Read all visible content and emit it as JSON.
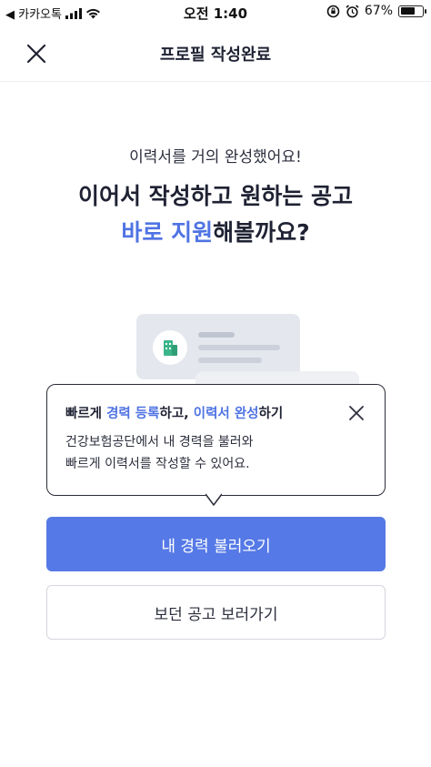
{
  "status_bar": {
    "back_app": "◀ 카카오톡",
    "time": "오전 1:40",
    "battery_percent": "67%",
    "battery_level": 0.67
  },
  "header": {
    "title": "프로필 작성완료"
  },
  "main": {
    "subtitle": "이력서를 거의 완성했어요!",
    "headline_line1": "이어서 작성하고 원하는 공고",
    "headline_accent": "바로 지원",
    "headline_tail": "해볼까요?"
  },
  "tooltip": {
    "title_part1": "빠르게 ",
    "title_accent1": "경력 등록",
    "title_part2": "하고, ",
    "title_accent2": "이력서 완성",
    "title_part3": "하기",
    "body_line1": "건강보험공단에서 내 경력을 불러와",
    "body_line2": "빠르게 이력서를 작성할 수 있어요."
  },
  "buttons": {
    "primary_label": "내 경력 불러오기",
    "secondary_label": "보던 공고 보러가기"
  },
  "colors": {
    "accent": "#4f73e3",
    "primary_button": "#5579e6",
    "illustration_icon": "#3bb58a"
  },
  "icons": {
    "close": "close-icon",
    "tooltip_close": "close-icon",
    "building": "building-icon"
  }
}
